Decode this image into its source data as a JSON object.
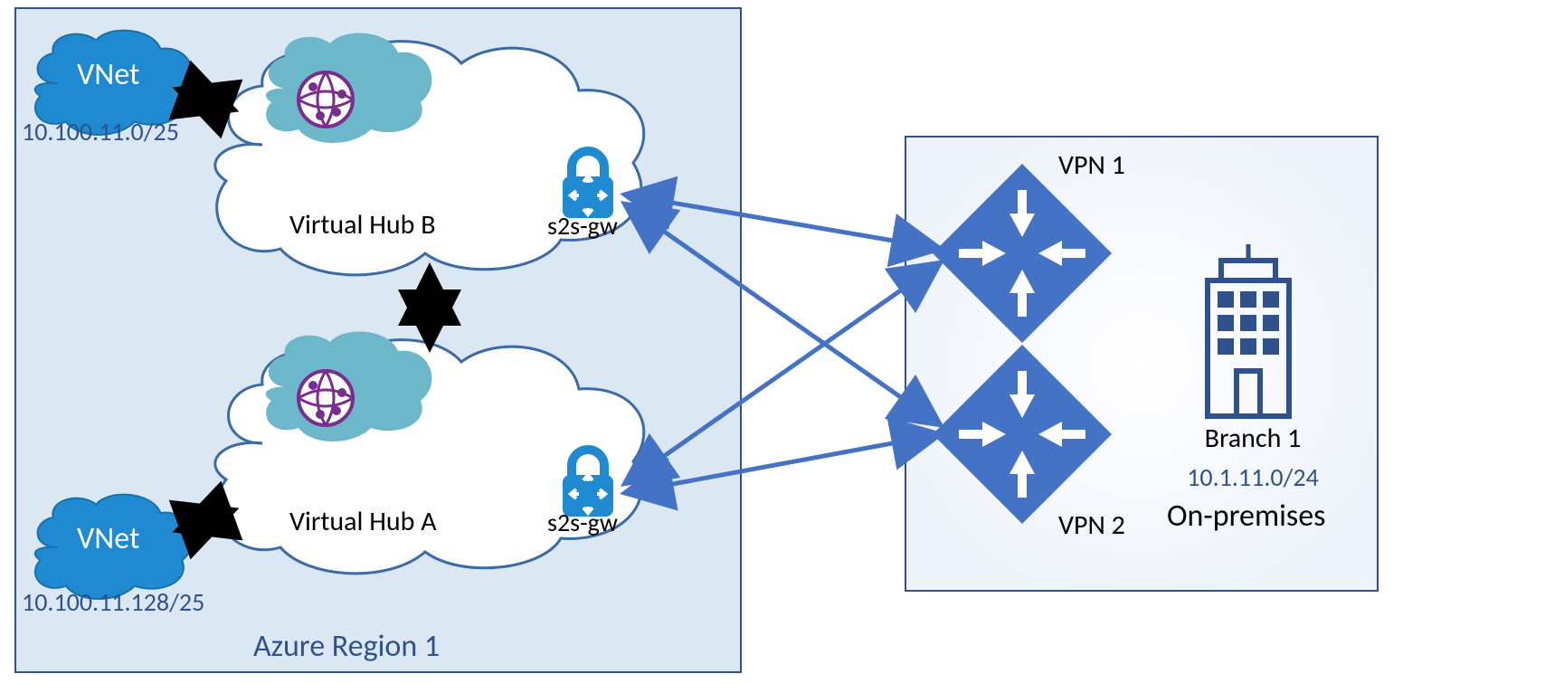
{
  "region": {
    "title": "Azure Region 1",
    "hubA": {
      "label": "Virtual Hub A",
      "gateway": "s2s-gw",
      "vnet": {
        "badge": "VNet",
        "cidr": "10.100.11.128/25"
      }
    },
    "hubB": {
      "label": "Virtual Hub B",
      "gateway": "s2s-gw",
      "vnet": {
        "badge": "VNet",
        "cidr": "10.100.11.0/25"
      }
    }
  },
  "onprem": {
    "title": "On-premises",
    "branch": {
      "label": "Branch 1",
      "cidr": "10.1.11.0/24"
    },
    "vpn1": "VPN 1",
    "vpn2": "VPN 2"
  },
  "connections": {
    "hubA_to_vpn1": true,
    "hubA_to_vpn2": true,
    "hubB_to_vpn1": true,
    "hubB_to_vpn2": true,
    "hubA_to_hubB": true,
    "hubA_to_vnetA": true,
    "hubB_to_vnetB": true
  }
}
